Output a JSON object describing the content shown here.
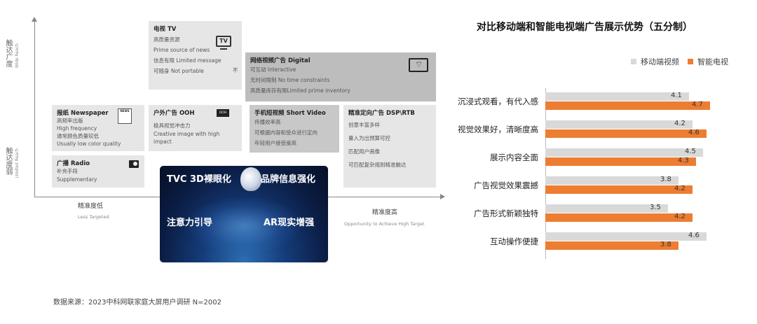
{
  "matrix": {
    "y_axis": {
      "top_cn": "触达广度",
      "top_en": "Wide Reach",
      "bottom_cn": "触达度弱",
      "bottom_en": "Limited Reach"
    },
    "x_axis": {
      "left_cn": "精准度低",
      "left_en": "Less Targeted",
      "right_cn": "精准度高",
      "right_en": "Opportunity to Achieve High Target"
    },
    "boxes": {
      "tv": {
        "title": "电视 TV",
        "lines": [
          "高质量资源",
          "Prime source of news",
          "信息有限 Limited message",
          "可随身 Not portable"
        ],
        "extra": "不",
        "icon_text": "TV"
      },
      "digital": {
        "title": "网络视频广告 Digital",
        "lines": [
          "可互动 Interactive",
          "无时间限制 No time constraints",
          "高质量库存有限Limited prime inventory"
        ]
      },
      "newspaper": {
        "title": "报纸 Newspaper",
        "lines": [
          "高频率出版",
          "High frequency",
          "通常颜色质量较低",
          "Usually low color quality"
        ],
        "icon_text": "NEWS"
      },
      "ooh": {
        "title": "户外广告 OOH",
        "lines": [
          "极具视觉冲击力",
          "Creative image with high",
          "impact"
        ],
        "icon_text": "OOH"
      },
      "short_video": {
        "title": "手机短视频 Short Video",
        "lines": [
          "传播效率高",
          "可根据内容和受众进行定向",
          "年轻用户接受度高"
        ]
      },
      "dsp": {
        "title": "精准定向广告 DSP\\RTB",
        "lines": [
          "创意丰富多样",
          "量入为出预算可控",
          "匹配用户画像",
          "可匹配复杂规则精准触达"
        ]
      },
      "radio": {
        "title": "广播 Radio",
        "lines": [
          "补充手段",
          "Supplementary"
        ]
      }
    },
    "tvc": {
      "t1": "TVC 3D裸眼化",
      "t2": "品牌信息强化",
      "t3": "注意力引导",
      "t4": "AR现实增强"
    }
  },
  "source": "数据来源：2023中科网联家庭大屏用户调研 N=2002",
  "colors": {
    "mobile": "#d9d9d9",
    "tv": "#ed7d31"
  },
  "chart_data": {
    "type": "bar",
    "orientation": "horizontal",
    "title": "对比移动端和智能电视端广告展示优势（五分制）",
    "categories": [
      "沉浸式观看，有代入感",
      "视觉效果好，清晰度高",
      "展示内容全面",
      "广告视觉效果震撼",
      "广告形式新颖独特",
      "互动操作便捷"
    ],
    "series": [
      {
        "name": "移动端视频",
        "values": [
          4.1,
          4.2,
          4.5,
          3.8,
          3.5,
          4.6
        ]
      },
      {
        "name": "智能电视",
        "values": [
          4.7,
          4.6,
          4.3,
          4.2,
          4.2,
          3.8
        ]
      }
    ],
    "value_labels": {
      "mobile": [
        "4.1",
        "4.2",
        "4.5",
        "3.8",
        "3.5",
        "4.6"
      ],
      "tv": [
        "4.7",
        "4.6",
        "4.3",
        "4.2",
        "4.2",
        "3.8"
      ]
    },
    "xlim": [
      0,
      5
    ],
    "legend": "top-right",
    "grid": false
  }
}
